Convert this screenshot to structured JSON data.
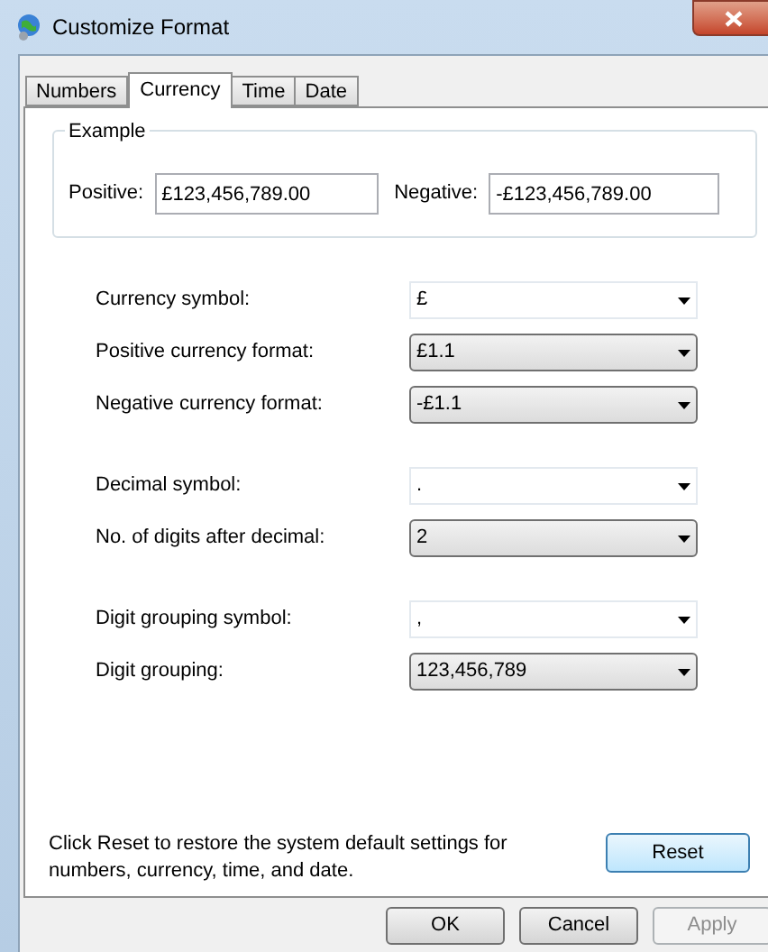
{
  "window": {
    "title": "Customize Format"
  },
  "tabs": [
    {
      "label": "Numbers",
      "selected": false
    },
    {
      "label": "Currency",
      "selected": true
    },
    {
      "label": "Time",
      "selected": false
    },
    {
      "label": "Date",
      "selected": false
    }
  ],
  "example": {
    "title": "Example",
    "positive_label": "Positive:",
    "positive_value": "£123,456,789.00",
    "negative_label": "Negative:",
    "negative_value": "-£123,456,789.00"
  },
  "setting_groups": [
    [
      {
        "label": "Currency symbol:",
        "value": "£",
        "kind": "editable"
      },
      {
        "label": "Positive currency format:",
        "value": "£1.1",
        "kind": "list"
      },
      {
        "label": "Negative currency format:",
        "value": "-£1.1",
        "kind": "list"
      }
    ],
    [
      {
        "label": "Decimal symbol:",
        "value": ".",
        "kind": "editable"
      },
      {
        "label": "No. of digits after decimal:",
        "value": "2",
        "kind": "list"
      }
    ],
    [
      {
        "label": "Digit grouping symbol:",
        "value": ",",
        "kind": "editable"
      },
      {
        "label": "Digit grouping:",
        "value": "123,456,789",
        "kind": "list"
      }
    ]
  ],
  "reset_note": "Click Reset to restore the system default settings for numbers, currency, time, and date.",
  "reset_button": "Reset",
  "buttons": [
    {
      "label": "OK",
      "disabled": false
    },
    {
      "label": "Cancel",
      "disabled": false
    },
    {
      "label": "Apply",
      "disabled": true
    }
  ]
}
